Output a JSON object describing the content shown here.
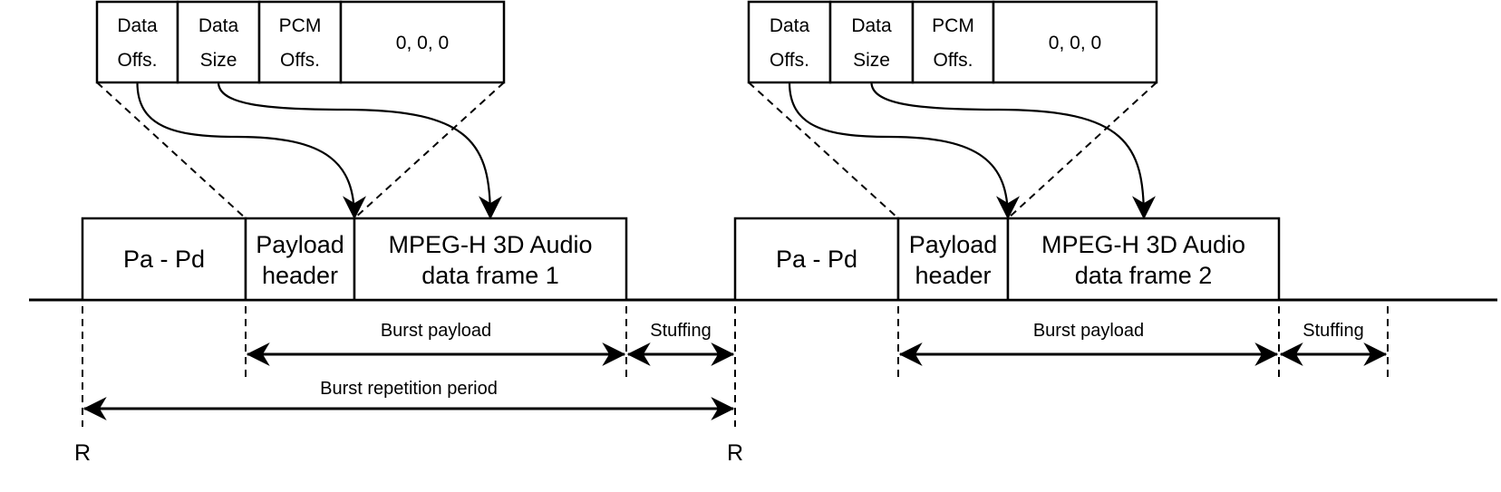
{
  "bursts": [
    {
      "header_fields": [
        [
          "Data",
          "Offs."
        ],
        [
          "Data",
          "Size"
        ],
        [
          "PCM",
          "Offs."
        ],
        [
          "0, 0, 0"
        ]
      ],
      "preamble": "Pa - Pd",
      "payload_header": [
        "Payload",
        "header"
      ],
      "frame": [
        "MPEG-H 3D Audio",
        "data frame 1"
      ],
      "burst_payload_label": "Burst payload",
      "stuffing_label": "Stuffing"
    },
    {
      "header_fields": [
        [
          "Data",
          "Offs."
        ],
        [
          "Data",
          "Size"
        ],
        [
          "PCM",
          "Offs."
        ],
        [
          "0, 0, 0"
        ]
      ],
      "preamble": "Pa - Pd",
      "payload_header": [
        "Payload",
        "header"
      ],
      "frame": [
        "MPEG-H 3D Audio",
        "data frame 2"
      ],
      "burst_payload_label": "Burst payload",
      "stuffing_label": "Stuffing"
    }
  ],
  "repetition_label": "Burst repetition period",
  "reference_marks": [
    "R",
    "R"
  ]
}
